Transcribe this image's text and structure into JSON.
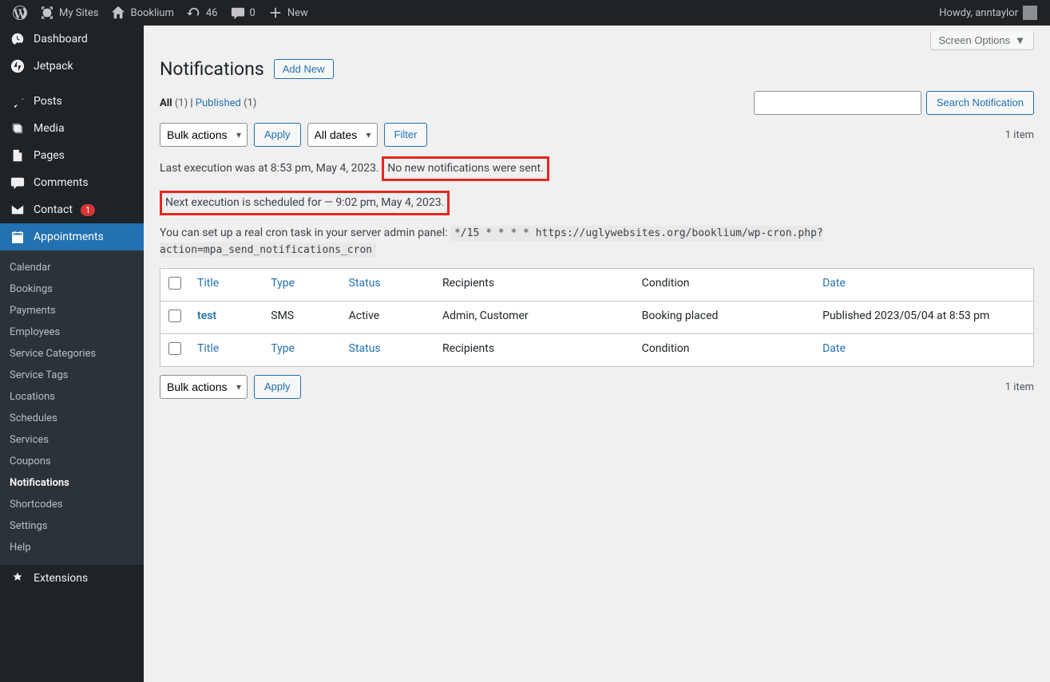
{
  "adminbar": {
    "my_sites": "My Sites",
    "site_name": "Booklium",
    "updates": "46",
    "comments": "0",
    "new": "New",
    "howdy": "Howdy, anntaylor"
  },
  "sidebar": {
    "dashboard": "Dashboard",
    "jetpack": "Jetpack",
    "posts": "Posts",
    "media": "Media",
    "pages": "Pages",
    "comments": "Comments",
    "contact": "Contact",
    "contact_badge": "1",
    "appointments": "Appointments",
    "extensions": "Extensions",
    "sub": {
      "calendar": "Calendar",
      "bookings": "Bookings",
      "payments": "Payments",
      "employees": "Employees",
      "service_categories": "Service Categories",
      "service_tags": "Service Tags",
      "locations": "Locations",
      "schedules": "Schedules",
      "services": "Services",
      "coupons": "Coupons",
      "notifications": "Notifications",
      "shortcodes": "Shortcodes",
      "settings": "Settings",
      "help": "Help"
    }
  },
  "page": {
    "screen_options": "Screen Options",
    "title": "Notifications",
    "add_new": "Add New",
    "filter_all": "All",
    "filter_all_count": "(1)",
    "filter_sep": "  |  ",
    "filter_published": "Published",
    "filter_published_count": "(1)",
    "search_btn": "Search Notification",
    "bulk_actions": "Bulk actions",
    "apply": "Apply",
    "all_dates": "All dates",
    "filter": "Filter",
    "item_count": "1 item",
    "exec_prefix": "Last execution was at 8:53 pm, May 4, 2023. ",
    "exec_highlight": "No new notifications were sent.",
    "next_exec": "Next execution is scheduled for — 9:02 pm, May 4, 2023.",
    "cron_intro": "You can set up a real cron task in your server admin panel: ",
    "cron_cmd": "*/15 * * * * https://uglywebsites.org/booklium/wp-cron.php?action=mpa_send_notifications_cron"
  },
  "table": {
    "cols": {
      "title": "Title",
      "type": "Type",
      "status": "Status",
      "recipients": "Recipients",
      "condition": "Condition",
      "date": "Date"
    },
    "rows": [
      {
        "title": "test",
        "type": "SMS",
        "status": "Active",
        "recipients": "Admin, Customer",
        "condition": "Booking placed",
        "date": "Published 2023/05/04 at 8:53 pm"
      }
    ]
  }
}
